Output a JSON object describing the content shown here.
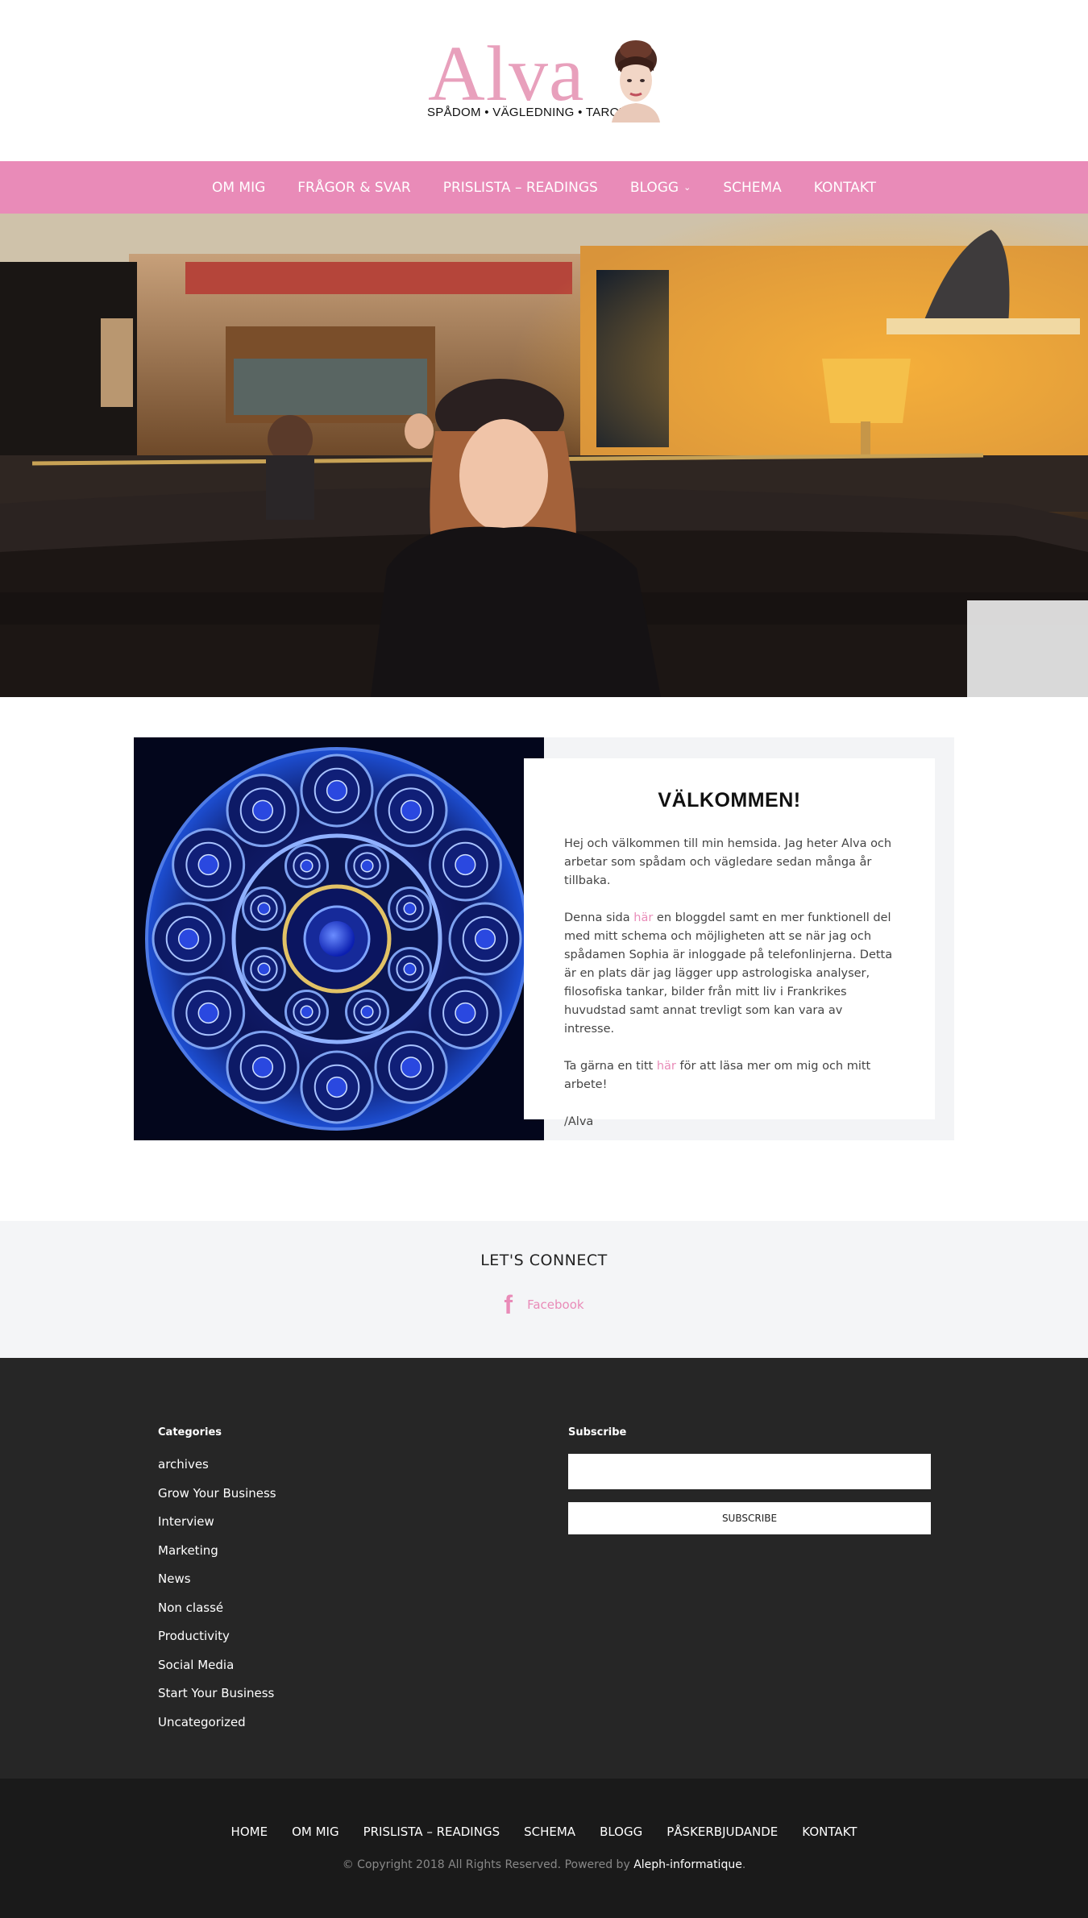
{
  "header": {
    "logo_text": "Alva",
    "logo_tagline": "SPÅDOM • VÄGLEDNING • TAROT"
  },
  "nav": {
    "items": [
      {
        "label": "OM MIG"
      },
      {
        "label": "FRÅGOR & SVAR"
      },
      {
        "label": "PRISLISTA – READINGS"
      },
      {
        "label": "BLOGG",
        "has_dropdown": true
      },
      {
        "label": "SCHEMA"
      },
      {
        "label": "KONTAKT"
      }
    ]
  },
  "welcome": {
    "title": "VÄLKOMMEN!",
    "p1": "Hej och välkommen till min hemsida. Jag heter Alva och arbetar som spådam och vägledare sedan många år tillbaka.",
    "p2_before": "Denna sida ",
    "p2_link": "här",
    "p2_after": " en bloggdel samt en mer funktionell del med mitt schema och möjligheten att se när jag och spådamen Sophia är inloggade på telefonlinjerna. Detta är en plats där jag lägger upp astrologiska analyser, filosofiska tankar, bilder från mitt liv i Frankrikes huvudstad samt annat trevligt som kan vara av intresse.",
    "p3_before": "Ta gärna en titt ",
    "p3_link": "här",
    "p3_after": " för att läsa mer om mig och mitt arbete!",
    "signature": "/Alva"
  },
  "connect": {
    "title": "LET'S CONNECT",
    "facebook_label": "Facebook",
    "facebook_icon": "facebook-icon"
  },
  "footer_widgets": {
    "categories_title": "Categories",
    "categories": [
      "archives",
      "Grow Your Business",
      "Interview",
      "Marketing",
      "News",
      "Non classé",
      "Productivity",
      "Social Media",
      "Start Your Business",
      "Uncategorized"
    ],
    "subscribe_title": "Subscribe",
    "subscribe_placeholder": "",
    "subscribe_button": "SUBSCRIBE"
  },
  "footer": {
    "nav": [
      "HOME",
      "OM MIG",
      "PRISLISTA – READINGS",
      "SCHEMA",
      "BLOGG",
      "PÅSKERBJUDANDE",
      "KONTAKT"
    ],
    "copyright_prefix": "© Copyright 2018 All Rights Reserved. Powered by ",
    "copyright_link": "Aleph-informatique",
    "copyright_suffix": "."
  },
  "colors": {
    "accent": "#e98bb8",
    "footer_dark": "#262626",
    "footer_bottom": "#1a1a1a"
  }
}
